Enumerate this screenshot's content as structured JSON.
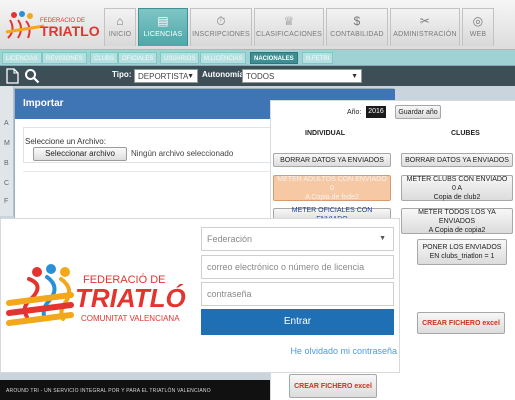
{
  "app": {
    "logo_text": "TRIATLO",
    "logo_subtext": "FEDERACIO DE",
    "nav_tabs": [
      {
        "label": "INICIO",
        "icon": "home-icon"
      },
      {
        "label": "LICENCIAS",
        "icon": "list-icon"
      },
      {
        "label": "INSCRIPCIONES",
        "icon": "stopwatch-icon"
      },
      {
        "label": "CLASIFICACIONES",
        "icon": "trophy-icon"
      },
      {
        "label": "CONTABILIDAD",
        "icon": "dollar-icon"
      },
      {
        "label": "ADMINISTRACIÓN",
        "icon": "tools-icon"
      },
      {
        "label": "WEB",
        "icon": "globe-icon"
      }
    ],
    "active_nav": "LICENCIAS",
    "sub_tabs": [
      "LICENCIAS",
      "REVISIONES",
      "CLUBS",
      "OFICIALES",
      "USUARIOS",
      "M.LICENCIAS",
      "NACIONALES",
      "N.FETRI"
    ],
    "active_sub_tab": "NACIONALES",
    "filter": {
      "tipo_label": "Tipo:",
      "tipo_value": "DEPORTISTA",
      "autonomia_label": "Autonomía:",
      "autonomia_value": "TODOS"
    },
    "left_strip_letters": [
      "A",
      "M",
      "B",
      "C",
      "F"
    ]
  },
  "import_modal": {
    "title": "Importar",
    "file_label": "Seleccione un Archivo:",
    "file_button": "Seleccionar archivo",
    "file_status": "Ningún archivo seleccionado"
  },
  "tools_panel": {
    "year_label": "Año:",
    "year_value": "2016",
    "save_year_button": "Guardar año",
    "individual_header": "INDIVIDUAL",
    "clubes_header": "CLUBES",
    "individual_buttons": [
      {
        "line1": "BORRAR DATOS YA ENVIADOS",
        "line2": ""
      },
      {
        "line1": "METER ADULTOS CON ENVIADO 0",
        "line2": "A Copia de fede2"
      },
      {
        "line1": "METER OFICIALES CON ENVIADO",
        "line2": ""
      }
    ],
    "clubes_buttons": [
      {
        "line1": "BORRAR DATOS YA ENVIADOS",
        "line2": ""
      },
      {
        "line1": "METER CLUBS CON ENVIADO 0 A",
        "line2": "Copia de club2"
      },
      {
        "line1": "METER TODOS LOS YA ENVIADOS",
        "line2": "A Copia de copia2"
      },
      {
        "line1": "PONER LOS ENVIADOS",
        "line2": "EN clubs_triatlon = 1"
      }
    ],
    "crear_fichero_right": "CREAR FICHERO excel",
    "crear_fichero_left": "CREAR FICHERO excel"
  },
  "login": {
    "logo_line1": "FEDERACIÓ DE",
    "logo_line2": "TRIATLÓ",
    "logo_line3": "COMUNITAT VALENCIANA",
    "select_value": "Federación",
    "email_placeholder": "correo electrónico o número de licencia",
    "password_placeholder": "contraseña",
    "submit_button": "Entrar",
    "forgot_link": "He olvidado mi contraseña"
  },
  "banner": {
    "text": "AROUND TRI - UN SERVICIO INTEGRAL POR Y PARA EL TRIATLÓN VALENCIANO"
  },
  "colors": {
    "teal_active": "#4fa6a8",
    "modal_header": "#3f74b5",
    "login_button": "#1e6fb3",
    "link": "#4f9ad6",
    "warn_button": "#f6c9a4",
    "red_text": "#d0301e"
  }
}
